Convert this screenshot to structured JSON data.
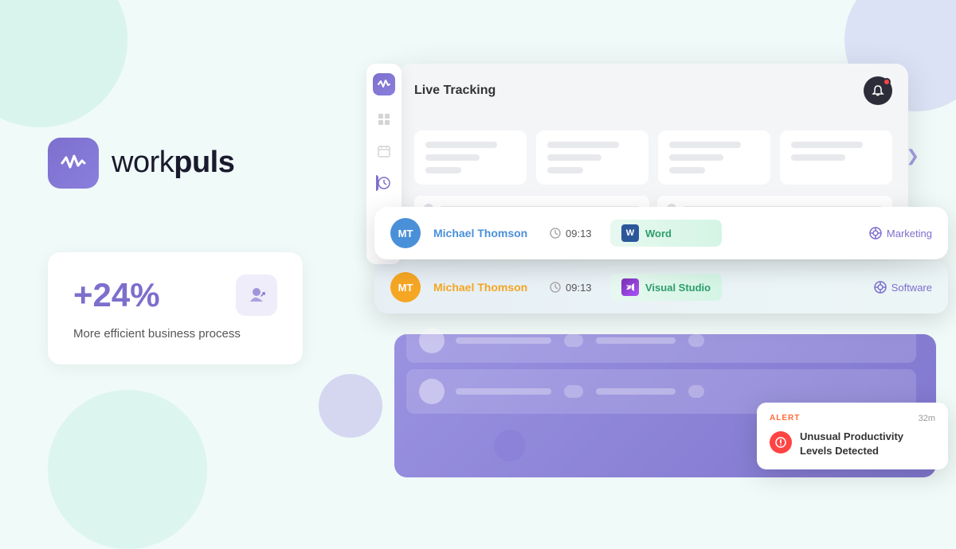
{
  "brand": {
    "name_regular": "work",
    "name_bold": "puls",
    "icon_label": "workpuls-logo-icon"
  },
  "stat_card": {
    "number": "+24%",
    "label": "More efficient business process",
    "icon": "efficiency-icon"
  },
  "dashboard": {
    "panel_title": "Live Tracking",
    "notification_icon": "bell-icon"
  },
  "tracking_rows": [
    {
      "avatar_initials": "MT",
      "avatar_color": "blue",
      "user_name": "Michael Thomson",
      "time": "09:13",
      "app_name": "Word",
      "app_icon": "word-icon",
      "department": "Marketing",
      "dept_icon": "marketing-icon"
    },
    {
      "avatar_initials": "MT",
      "avatar_color": "orange",
      "user_name": "Michael Thomson",
      "time": "09:13",
      "app_name": "Visual Studio",
      "app_icon": "vs-icon",
      "department": "Software",
      "dept_icon": "software-icon"
    }
  ],
  "alert": {
    "label": "ALERT",
    "time": "32m",
    "message": "Unusual Productivity Levels Detected",
    "icon": "alert-icon"
  },
  "sidebar_items": [
    {
      "icon": "grid-icon",
      "active": false
    },
    {
      "icon": "calendar-icon",
      "active": false
    },
    {
      "icon": "clock-icon",
      "active": true
    },
    {
      "icon": "image-icon",
      "active": false
    },
    {
      "icon": "users-icon",
      "active": false
    }
  ]
}
